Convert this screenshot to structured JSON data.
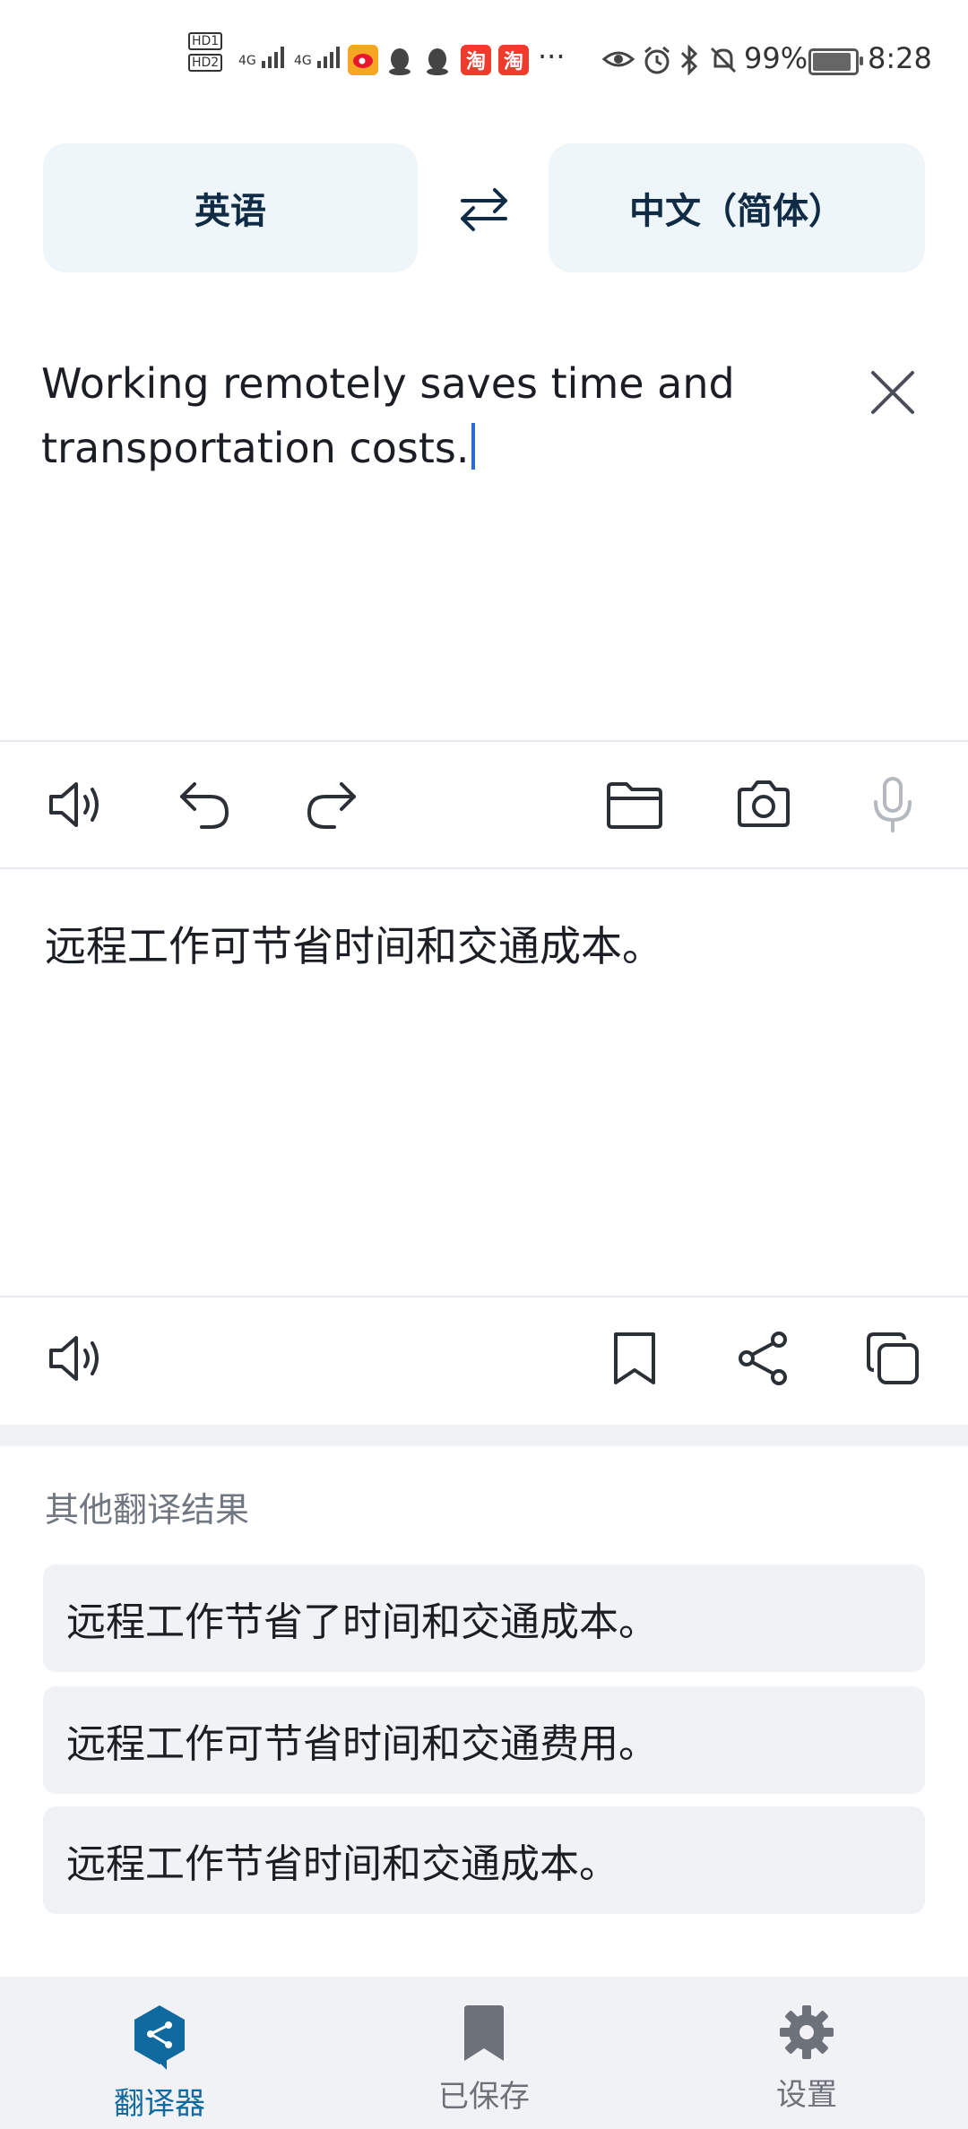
{
  "status_bar": {
    "hd1": "HD1",
    "hd2": "HD2",
    "net1": "4G",
    "net2": "4G",
    "more": "···",
    "battery": "99%",
    "battery_level": 0.99,
    "time": "8:28",
    "taobao1": "淘",
    "taobao2": "淘"
  },
  "language_bar": {
    "source": "英语",
    "target": "中文（简体）"
  },
  "input": {
    "line1": "Working remotely saves time and",
    "line2_a": "transportation",
    "line2_b": "costs."
  },
  "translation": {
    "text": "远程工作可节省时间和交通成本。"
  },
  "alternatives": {
    "title": "其他翻译结果",
    "items": [
      "远程工作节省了时间和交通成本。",
      "远程工作可节省时间和交通费用。",
      "远程工作节省时间和交通成本。"
    ]
  },
  "bottom_nav": {
    "translator": "翻译器",
    "saved": "已保存",
    "settings": "设置"
  },
  "colors": {
    "accent": "#0f6aa0",
    "nav_inactive": "#6d727a"
  }
}
